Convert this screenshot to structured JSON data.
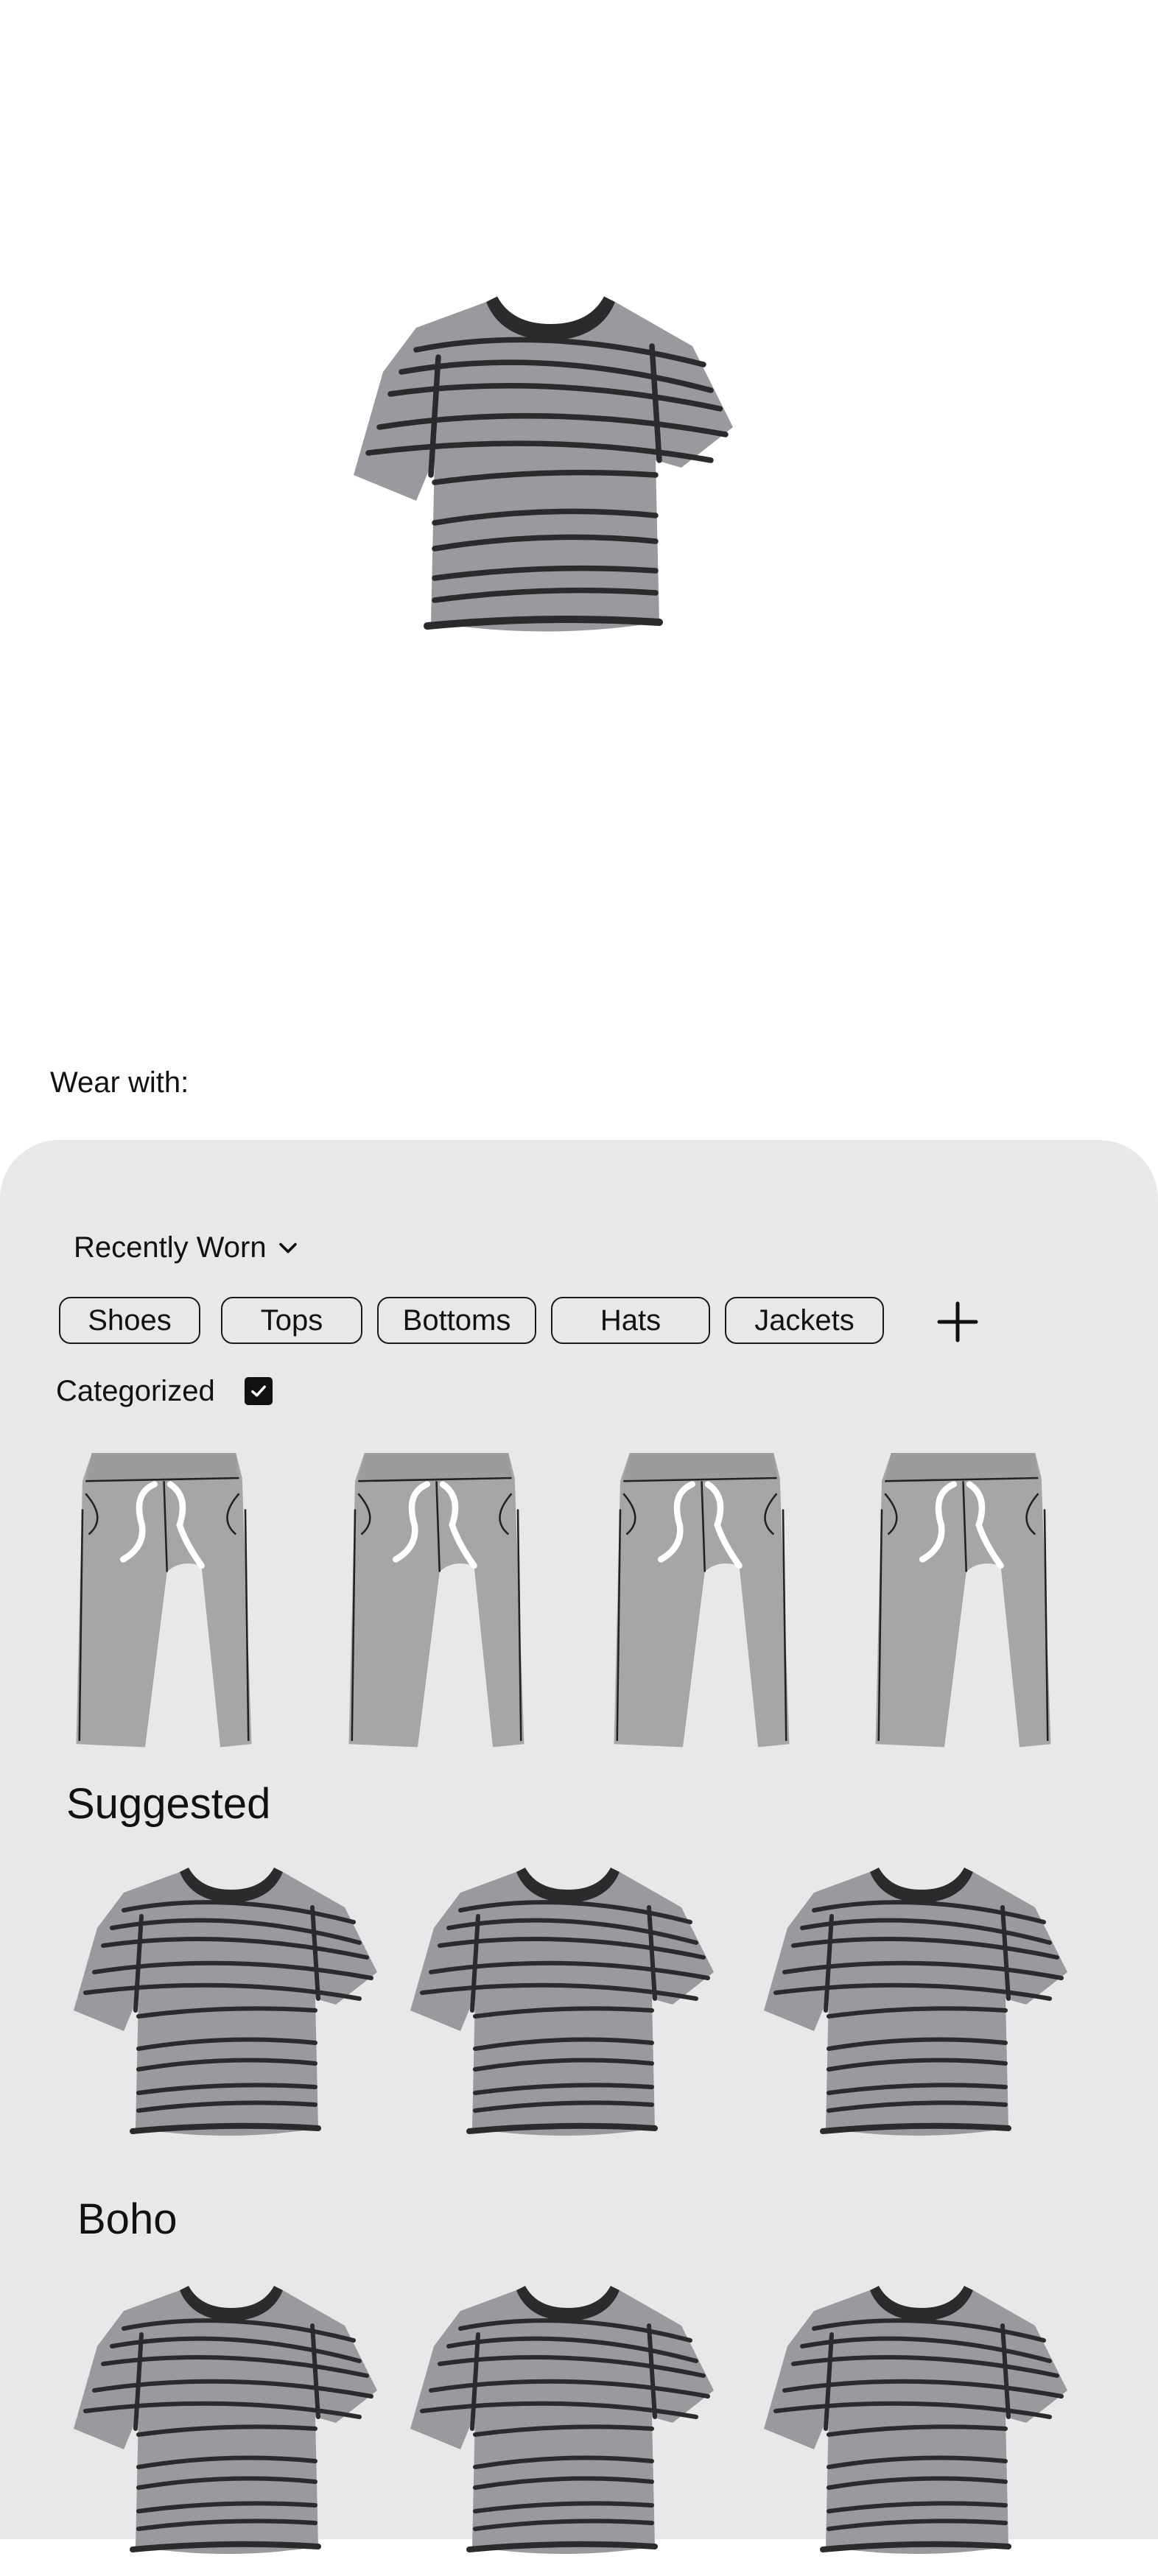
{
  "hero": {
    "item_icon": "striped-tshirt-illustration"
  },
  "wear_with_label": "Wear with:",
  "sort": {
    "label": "Recently Worn",
    "icon": "chevron-down-icon"
  },
  "categories": [
    "Shoes",
    "Tops",
    "Bottoms",
    "Hats",
    "Jackets"
  ],
  "add_category_icon": "plus-icon",
  "categorized": {
    "label": "Categorized",
    "checked": true
  },
  "recent_items": [
    "grey-sweatpants",
    "grey-sweatpants",
    "grey-sweatpants",
    "grey-sweatpants"
  ],
  "sections": [
    {
      "title": "Suggested",
      "items": [
        "striped-tshirt",
        "striped-tshirt",
        "striped-tshirt"
      ]
    },
    {
      "title": "Boho",
      "items": [
        "striped-tshirt",
        "striped-tshirt",
        "striped-tshirt"
      ]
    }
  ],
  "colors": {
    "panel_bg": "#e8e8e8",
    "garment_grey": "#9a9a9e",
    "stripe": "#2b2b2e"
  }
}
